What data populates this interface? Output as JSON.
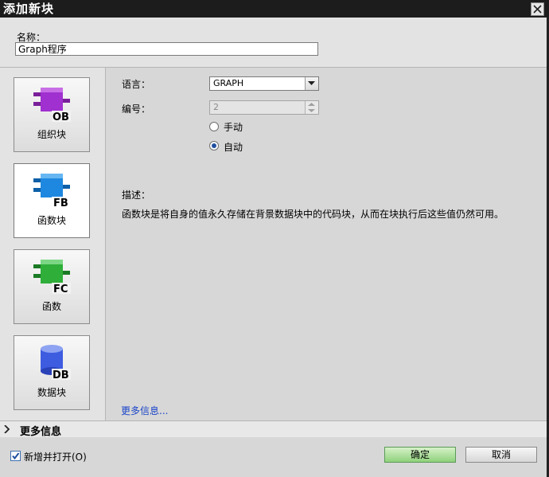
{
  "window": {
    "title": "添加新块"
  },
  "name_field": {
    "label": "名称：",
    "value": "Graph程序"
  },
  "block_types": [
    {
      "label": "组织块",
      "icon": "ob-block-icon",
      "badge": "OB",
      "color": "#a030d0"
    },
    {
      "label": "函数块",
      "icon": "fb-block-icon",
      "badge": "FB",
      "color": "#1e88e0"
    },
    {
      "label": "函数",
      "icon": "fc-block-icon",
      "badge": "FC",
      "color": "#2fae3a"
    },
    {
      "label": "数据块",
      "icon": "db-block-icon",
      "badge": "DB",
      "color": "#3d5ce0"
    }
  ],
  "form": {
    "language_label": "语言：",
    "language_value": "GRAPH",
    "number_label": "编号：",
    "number_value": "2",
    "radio_manual": "手动",
    "radio_auto": "自动",
    "selected_mode": "自动"
  },
  "description": {
    "label": "描述：",
    "text": "函数块是将自身的值永久存储在背景数据块中的代码块，从而在块执行后这些值仍然可用。"
  },
  "more_info_link": "更多信息...",
  "more_info_bar": "更多信息",
  "footer": {
    "checkbox_label": "新增并打开(O)",
    "checkbox_checked": true,
    "ok": "确定",
    "cancel": "取消"
  },
  "colors": {
    "ok_button": "#8fd27c",
    "link": "#1a45c8",
    "title_bar": "#1c1c1c"
  }
}
